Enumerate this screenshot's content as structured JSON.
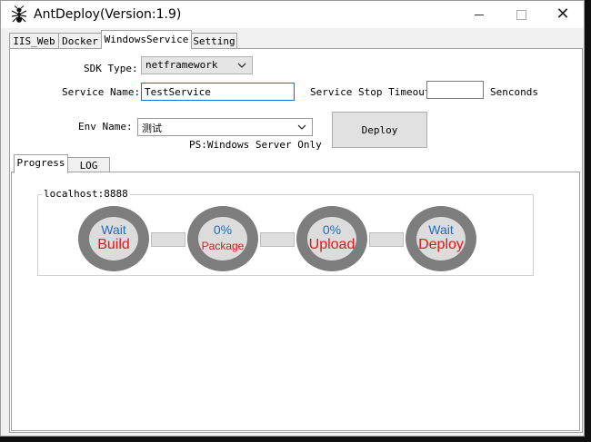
{
  "window": {
    "title": "AntDeploy(Version:1.9)",
    "close_glyph": "✕"
  },
  "tabs": [
    {
      "label": "IIS_Web"
    },
    {
      "label": "Docker"
    },
    {
      "label": "WindowsService"
    },
    {
      "label": "Setting"
    }
  ],
  "form": {
    "sdk_type_label": "SDK Type:",
    "sdk_type_value": "netframework",
    "service_name_label": "Service Name:",
    "service_name_value": "TestService",
    "stop_timeout_label": "Service Stop Timeout:",
    "stop_timeout_value": "",
    "stop_timeout_unit": "Senconds",
    "env_name_label": "Env Name:",
    "env_name_value": "测试",
    "deploy_button": "Deploy",
    "ps_note": "PS:Windows Server Only"
  },
  "inner_tabs": [
    {
      "label": "Progress"
    },
    {
      "label": "LOG"
    }
  ],
  "progress": {
    "host": "localhost:8888",
    "stages": [
      {
        "status": "Wait",
        "name": "Build"
      },
      {
        "status": "0%",
        "name": "Package"
      },
      {
        "status": "0%",
        "name": "Upload"
      },
      {
        "status": "Wait",
        "name": "Deploy"
      }
    ]
  }
}
